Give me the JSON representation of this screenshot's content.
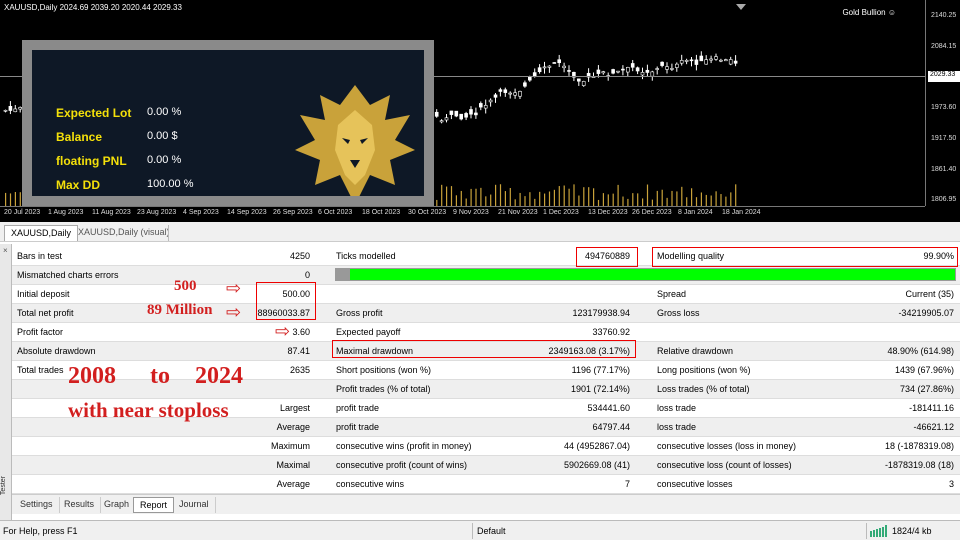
{
  "chart": {
    "title": "XAUUSD,Daily  2024.69 2039.20 2020.44 2029.33",
    "brand": "Gold Bullion",
    "brand_icon": "smiley-icon",
    "yticks": [
      "2140.25",
      "2084.15",
      "1973.60",
      "1917.50",
      "1861.40",
      "1806.95"
    ],
    "current_price": "2029.33",
    "xticks": [
      "20 Jul 2023",
      "1 Aug 2023",
      "11 Aug 2023",
      "23 Aug 2023",
      "4 Sep 2023",
      "14 Sep 2023",
      "26 Sep 2023",
      "6 Oct 2023",
      "18 Oct 2023",
      "30 Oct 2023",
      "9 Nov 2023",
      "21 Nov 2023",
      "1 Dec 2023",
      "13 Dec 2023",
      "26 Dec 2023",
      "8 Jan 2024",
      "18 Jan 2024"
    ]
  },
  "panel": {
    "items": [
      {
        "label": "Expected Lot",
        "value": "0.00 %"
      },
      {
        "label": "Balance",
        "value": "0.00 $"
      },
      {
        "label": "floating PNL",
        "value": "0.00 %"
      },
      {
        "label": "Max DD",
        "value": "100.00 %"
      }
    ]
  },
  "chart_tabs": [
    "XAUUSD,Daily",
    "XAUUSD,Daily (visual)"
  ],
  "report": {
    "bars_label": "Bars in test",
    "bars": "4250",
    "ticks_label": "Ticks modelled",
    "ticks": "494760889",
    "mq_label": "Modelling quality",
    "mq": "99.90%",
    "mismatch_label": "Mismatched charts errors",
    "mismatch": "0",
    "initdep_label": "Initial deposit",
    "initdep": "500.00",
    "spread_label": "Spread",
    "spread": "Current (35)",
    "netprofit_label": "Total net profit",
    "netprofit": "88960033.87",
    "gross_profit_label": "Gross profit",
    "gross_profit": "123179938.94",
    "gross_loss_label": "Gross loss",
    "gross_loss": "-34219905.07",
    "pf_label": "Profit factor",
    "pf": "3.60",
    "ep_label": "Expected payoff",
    "ep": "33760.92",
    "absdd_label": "Absolute drawdown",
    "absdd": "87.41",
    "maxdd_label": "Maximal drawdown",
    "maxdd": "2349163.08 (3.17%)",
    "reldd_label": "Relative drawdown",
    "reldd": "48.90% (614.98)",
    "tt_label": "Total trades",
    "tt": "2635",
    "sp_label": "Short positions (won %)",
    "sp": "1196 (77.17%)",
    "lp_label": "Long positions (won %)",
    "lp": "1439 (67.96%)",
    "pt_label": "Profit trades (% of total)",
    "pt": "1901 (72.14%)",
    "lt_label": "Loss trades (% of total)",
    "lt": "734 (27.86%)",
    "largest_label": "Largest",
    "lpt_label": "profit trade",
    "lpt": "534441.60",
    "llt_label": "loss trade",
    "llt": "-181411.16",
    "average_label": "Average",
    "apt_label": "profit trade",
    "apt": "64797.44",
    "alt_label": "loss trade",
    "alt": "-46621.12",
    "maximum_label": "Maximum",
    "mcw_label": "consecutive wins (profit in money)",
    "mcw": "44 (4952867.04)",
    "mcl_label": "consecutive losses (loss in money)",
    "mcl": "18 (-1878319.08)",
    "maximal_label": "Maximal",
    "mcp_label": "consecutive profit (count of wins)",
    "mcp": "5902669.08 (41)",
    "mcll_label": "consecutive loss (count of losses)",
    "mcll": "-1878319.08 (18)",
    "average2_label": "Average",
    "acw_label": "consecutive wins",
    "acw": "7",
    "acl_label": "consecutive losses",
    "acl": "3"
  },
  "annotations": {
    "a500": "500",
    "a89": "89 Million",
    "years_from": "2008",
    "years_to": "to",
    "years_end": "2024",
    "stoploss": "with near stoploss"
  },
  "bottom_tabs": [
    "Settings",
    "Results",
    "Graph",
    "Report",
    "Journal"
  ],
  "side_label": "Tester",
  "status": {
    "help": "For Help, press F1",
    "profile": "Default",
    "traffic": "1824/4 kb"
  },
  "colors": {
    "quality_bar": "#00ff00",
    "annotation": "#d21f1f",
    "panel_label": "#f4e00a"
  }
}
